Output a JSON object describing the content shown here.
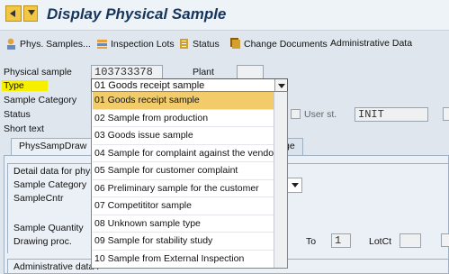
{
  "header": {
    "title": "Display Physical Sample"
  },
  "toolbar": {
    "phys_samples": "Phys. Samples...",
    "inspection_lots": "Inspection Lots",
    "status": "Status",
    "change_documents": "Change Documents",
    "administrative_data": "Administrative Data"
  },
  "form": {
    "physical_sample_label": "Physical sample",
    "physical_sample_value": "103733378",
    "plant_label": "Plant",
    "type_label": "Type",
    "type_value": "01 Goods receipt sample",
    "sample_category_label": "Sample Category",
    "status_label": "Status",
    "user_status_label": "User st.",
    "user_status_value": "INIT",
    "short_text_label": "Short text"
  },
  "dropdown": {
    "options": [
      "01 Goods receipt sample",
      "02 Sample from production",
      "03 Goods issue sample",
      "04 Sample for complaint against the vendor",
      "05 Sample for customer complaint",
      "06 Preliminary sample for the customer",
      "07 Competititor sample",
      "08 Unknown sample type",
      "09 Sample for stability study",
      "10 Sample from External Inspection"
    ],
    "selected_index": 0
  },
  "tabs": {
    "phys_samp_draw": "PhysSampDraw",
    "partial_right": "ge"
  },
  "detail": {
    "group_title": "Detail data for physic",
    "sample_category_label": "Sample Category",
    "sample_cntr_label": "SampleCntr",
    "sample_quantity_label": "Sample Quantity",
    "drawing_proc_label": "Drawing proc.",
    "to_label": "To",
    "to_value": "1",
    "lotct_label": "LotCt",
    "admin_data_label": "Administrative data f"
  }
}
